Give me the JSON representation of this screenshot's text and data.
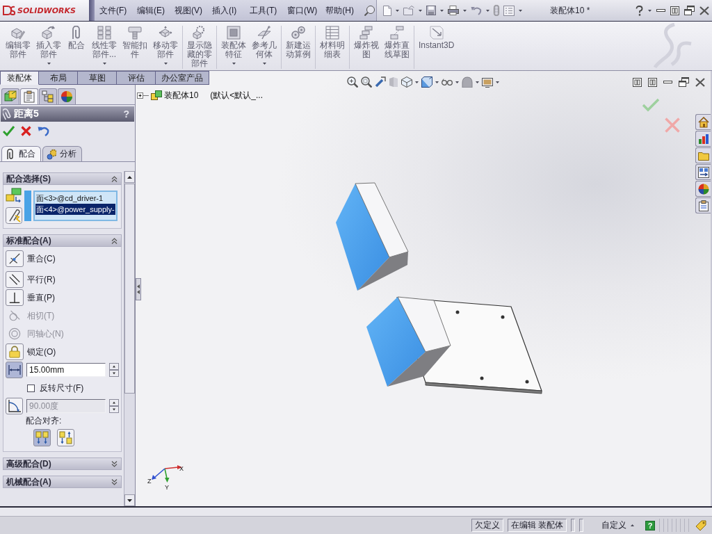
{
  "title_bar": {
    "logo": "SOLIDWORKS",
    "menu": [
      "文件(F)",
      "编辑(E)",
      "视图(V)",
      "插入(I)",
      "工具(T)",
      "窗口(W)",
      "帮助(H)"
    ],
    "document_title": "装配体10 *"
  },
  "command_manager": {
    "groups": [
      [
        {
          "kind": "edit",
          "lines": [
            "编辑零",
            "部件"
          ],
          "dropdown": false
        },
        {
          "kind": "insert",
          "lines": [
            "插入零",
            "部件"
          ],
          "dropdown": true
        },
        {
          "kind": "mate",
          "lines": [
            "配合"
          ],
          "dropdown": false
        },
        {
          "kind": "pattern",
          "lines": [
            "线性零",
            "部件..."
          ],
          "dropdown": true
        },
        {
          "kind": "fastener",
          "lines": [
            "智能扣",
            "件"
          ],
          "dropdown": false
        },
        {
          "kind": "move",
          "lines": [
            "移动零",
            "部件"
          ],
          "dropdown": true
        }
      ],
      [
        {
          "kind": "show",
          "lines": [
            "显示隐",
            "藏的零",
            "部件"
          ],
          "dropdown": false
        }
      ],
      [
        {
          "kind": "feature",
          "lines": [
            "装配体",
            "特征"
          ],
          "dropdown": true
        },
        {
          "kind": "reference",
          "lines": [
            "参考几",
            "何体"
          ],
          "dropdown": true
        }
      ],
      [
        {
          "kind": "motion",
          "lines": [
            "新建运",
            "动算例"
          ],
          "dropdown": false
        }
      ],
      [
        {
          "kind": "bom",
          "lines": [
            "材料明",
            "细表"
          ],
          "dropdown": false
        }
      ],
      [
        {
          "kind": "explode",
          "lines": [
            "爆炸视",
            "图"
          ],
          "dropdown": false
        },
        {
          "kind": "explodeline",
          "lines": [
            "爆炸直",
            "线草图"
          ],
          "dropdown": false
        }
      ],
      [
        {
          "kind": "instant3d",
          "lines": [
            "Instant3D"
          ],
          "dropdown": false
        }
      ]
    ],
    "tabs": [
      {
        "label": "装配体",
        "selected": true
      },
      {
        "label": "布局",
        "selected": false
      },
      {
        "label": "草图",
        "selected": false
      },
      {
        "label": "评估",
        "selected": false
      },
      {
        "label": "办公室产品",
        "selected": false
      }
    ]
  },
  "panel_tabs": [
    {
      "kind": "tree",
      "selected": false
    },
    {
      "kind": "property",
      "selected": true
    },
    {
      "kind": "configuration",
      "selected": false
    },
    {
      "kind": "display",
      "selected": false
    }
  ],
  "property_manager": {
    "title": "距离5",
    "help": "?",
    "tabs": [
      {
        "kind": "mate",
        "label": "配合",
        "selected": true
      },
      {
        "kind": "analysis",
        "label": "分析",
        "selected": false
      }
    ],
    "sections": [
      {
        "kind": "selection",
        "title": "配合选择(S)",
        "expanded": true,
        "items": [
          {
            "text": "面<3>@cd_driver-1",
            "selected": false
          },
          {
            "text": "面<4>@power_supply-",
            "selected": true
          }
        ]
      },
      {
        "kind": "standard",
        "title": "标准配合(A)",
        "expanded": true,
        "mates": [
          {
            "kind": "coincident",
            "label": "重合(C)",
            "disabled": false,
            "selected": false
          },
          {
            "kind": "parallel",
            "label": "平行(R)",
            "disabled": false,
            "selected": false
          },
          {
            "kind": "perpendicular",
            "label": "垂直(P)",
            "disabled": false,
            "selected": false
          },
          {
            "kind": "tangent",
            "label": "相切(T)",
            "disabled": true,
            "selected": false
          },
          {
            "kind": "concentric",
            "label": "同轴心(N)",
            "disabled": true,
            "selected": false
          },
          {
            "kind": "lock",
            "label": "锁定(O)",
            "disabled": false,
            "selected": false
          }
        ],
        "distance": {
          "value": "15.00mm",
          "selected": true,
          "disabled": false
        },
        "flip": {
          "label": "反转尺寸(F)",
          "checked": false
        },
        "angle": {
          "value": "90.00度",
          "selected": false,
          "disabled": true
        },
        "alignment": {
          "label": "配合对齐:",
          "options": [
            {
              "kind": "aligned",
              "selected": true
            },
            {
              "kind": "anti",
              "selected": false
            }
          ]
        }
      },
      {
        "title": "高级配合(D)",
        "expanded": false
      },
      {
        "title": "机械配合(A)",
        "expanded": false
      }
    ]
  },
  "feature_tree": {
    "expanded": false,
    "name": "装配体10",
    "configuration": "(默认<默认_..."
  },
  "triad": {
    "x": "X",
    "y": "Y",
    "z": "Z"
  },
  "status_bar": {
    "items": [
      {
        "kind": "text",
        "label": "欠定义"
      },
      {
        "kind": "text",
        "label": "在编辑 装配体"
      },
      {
        "kind": "menu",
        "label": "自定义"
      }
    ],
    "help": "?"
  }
}
